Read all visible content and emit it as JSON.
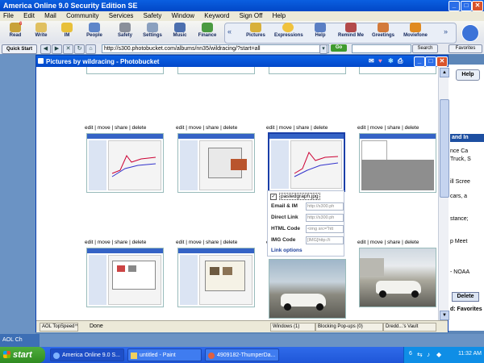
{
  "aol": {
    "title": "America Online 9.0 Security Edition SE",
    "menu": [
      "File",
      "Edit",
      "Mail",
      "Community",
      "Services",
      "Safety",
      "Window",
      "Keyword",
      "Sign Off",
      "Help"
    ],
    "toolbar_left": [
      "Read",
      "Write",
      "IM",
      "People",
      "Safety",
      "Settings",
      "Music",
      "Finance"
    ],
    "toolbar_right": [
      "Pictures",
      "Expressions",
      "Help",
      "Remind Me",
      "Greetings",
      "Moviefone"
    ],
    "quick_start": "Quick Start",
    "address": "http://s300.photobucket.com/albums/nn35/wildracing/?start=all",
    "go": "Go",
    "search": "Search",
    "favorites": "Favorites",
    "read_badge": "6"
  },
  "right_pane": {
    "help": "Help",
    "heading": "and In",
    "lines": [
      "nce Ca",
      "Truck, S",
      "ill Scree",
      "cars, a",
      "stance;",
      "p Meet",
      "- NOAA"
    ],
    "delete": "Delete",
    "favorites_label": "d: Favorites"
  },
  "window": {
    "title": "Pictures by wildracing - Photobucket",
    "status": "Done",
    "status_tool": "AOL TopSpeed™",
    "status_windows": "Windows (1)",
    "status_popups": "Blocking Pop-ups (0)",
    "status_vault": "Dredd...'s Vault"
  },
  "photos": {
    "link_edit": "edit",
    "link_move": "move",
    "link_share": "share",
    "link_delete": "delete",
    "sep": " | "
  },
  "popup": {
    "filename": "pastedgraph.jpg",
    "rows": [
      {
        "label": "Email & IM",
        "value": "http://s300.ph"
      },
      {
        "label": "Direct Link",
        "value": "http://s300.ph"
      },
      {
        "label": "HTML Code",
        "value": "<img src=\"htt"
      },
      {
        "label": "IMG Code",
        "value": "[IMG]http://i"
      }
    ],
    "link_options": "Link options"
  },
  "bottom": {
    "aol_chat": "AOL Ch"
  },
  "taskbar": {
    "start": "start",
    "tasks": [
      "America Online 9.0 S...",
      "untitled - Paint",
      "4909182-ThumperDa..."
    ],
    "tray_count": "6",
    "clock": "11:32 AM"
  }
}
